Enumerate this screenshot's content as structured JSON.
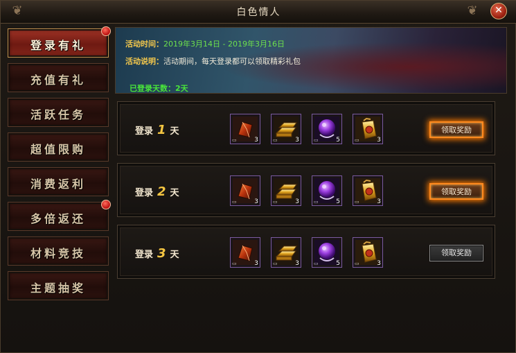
{
  "window": {
    "title": "白色情人",
    "close_icon": "close-icon"
  },
  "sidebar": {
    "items": [
      {
        "label": "登录有礼",
        "active": true,
        "badge": true
      },
      {
        "label": "充值有礼",
        "active": false,
        "badge": false
      },
      {
        "label": "活跃任务",
        "active": false,
        "badge": false
      },
      {
        "label": "超值限购",
        "active": false,
        "badge": false
      },
      {
        "label": "消费返利",
        "active": false,
        "badge": false
      },
      {
        "label": "多倍返还",
        "active": false,
        "badge": true
      },
      {
        "label": "材料竞技",
        "active": false,
        "badge": false
      },
      {
        "label": "主题抽奖",
        "active": false,
        "badge": false
      }
    ]
  },
  "banner": {
    "time_key": "活动时间：",
    "time_value": "2019年3月14日  -  2019年3月16日",
    "desc_key": "活动说明：",
    "desc_value": "活动期间，每天登录都可以领取精彩礼包",
    "days_label": "已登录天数：2天"
  },
  "rewards": [
    {
      "prefix": "登录",
      "day": "1",
      "suffix": "天",
      "items": [
        {
          "icon": "red-gem-icon",
          "count": "3"
        },
        {
          "icon": "gold-bar-icon",
          "count": "3"
        },
        {
          "icon": "purple-orb-icon",
          "count": "5"
        },
        {
          "icon": "scroll-bag-icon",
          "count": "3"
        }
      ],
      "button": "领取奖励",
      "button_state": "active"
    },
    {
      "prefix": "登录",
      "day": "2",
      "suffix": "天",
      "items": [
        {
          "icon": "red-gem-icon",
          "count": "3"
        },
        {
          "icon": "gold-bar-icon",
          "count": "3"
        },
        {
          "icon": "purple-orb-icon",
          "count": "5"
        },
        {
          "icon": "scroll-bag-icon",
          "count": "3"
        }
      ],
      "button": "领取奖励",
      "button_state": "active"
    },
    {
      "prefix": "登录",
      "day": "3",
      "suffix": "天",
      "items": [
        {
          "icon": "red-gem-icon",
          "count": "3"
        },
        {
          "icon": "gold-bar-icon",
          "count": "3"
        },
        {
          "icon": "purple-orb-icon",
          "count": "5"
        },
        {
          "icon": "scroll-bag-icon",
          "count": "3"
        }
      ],
      "button": "领取奖励",
      "button_state": "disabled"
    }
  ],
  "colors": {
    "accent": "#f4c84c",
    "green": "#49e63a",
    "glow": "#ff8a1f"
  }
}
